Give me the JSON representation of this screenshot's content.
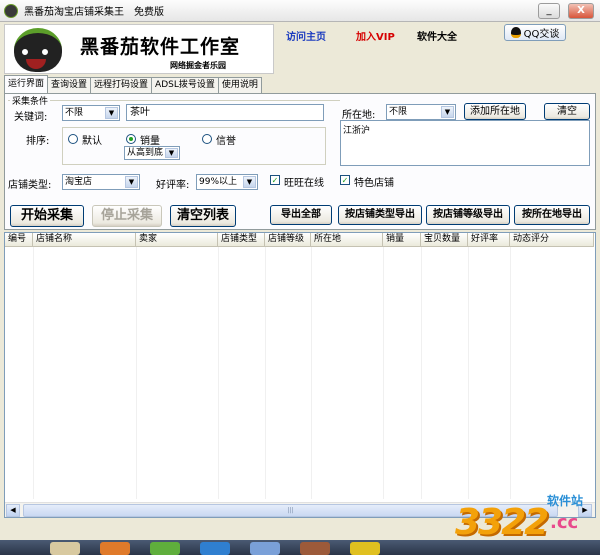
{
  "window": {
    "title": "黑番茄淘宝店铺采集王",
    "edition": "免费版",
    "minimize": "_",
    "close": "X"
  },
  "header": {
    "logo_title": "黑番茄软件工作室",
    "logo_subtitle": "网络掘金者乐园",
    "links": [
      "访问主页",
      "加入VIP",
      "软件大全"
    ],
    "qq_button": "QQ交谈",
    "colors": {
      "visit": "#1a3bbf",
      "vip": "#d60000",
      "software": "#000000"
    }
  },
  "tabs": [
    "运行界面",
    "查询设置",
    "远程打码设置",
    "ADSL拨号设置",
    "使用说明"
  ],
  "form": {
    "group_label": "采集条件",
    "keyword_label": "关键词:",
    "keyword_scope": "不限",
    "keyword_value": "茶叶",
    "location_label": "所在地:",
    "location_value": "不限",
    "add_location_button": "添加所在地",
    "clear_button": "清空",
    "location_list": "江浙沪",
    "sort_label": "排序:",
    "sort_options": [
      "默认",
      "销量",
      "信誉"
    ],
    "sort_selected": "销量",
    "sort_order": "从高到底",
    "shop_type_label": "店铺类型:",
    "shop_type_value": "淘宝店",
    "rating_label": "好评率:",
    "rating_value": "99%以上",
    "wangwang_label": "旺旺在线",
    "wangwang_checked": true,
    "feature_label": "特色店铺",
    "feature_checked": true
  },
  "actions": {
    "start": "开始采集",
    "stop": "停止采集",
    "clear_list": "清空列表",
    "export_all": "导出全部",
    "export_by_type": "按店铺类型导出",
    "export_by_level": "按店铺等级导出",
    "export_by_location": "按所在地导出"
  },
  "table": {
    "columns": [
      "编号",
      "店铺名称",
      "卖家",
      "店铺类型",
      "店铺等级",
      "所在地",
      "销量",
      "宝贝数量",
      "好评率",
      "动态评分"
    ],
    "rows": []
  },
  "watermark": {
    "number": "3322",
    "site": "软件站",
    "domain": ".cc"
  }
}
